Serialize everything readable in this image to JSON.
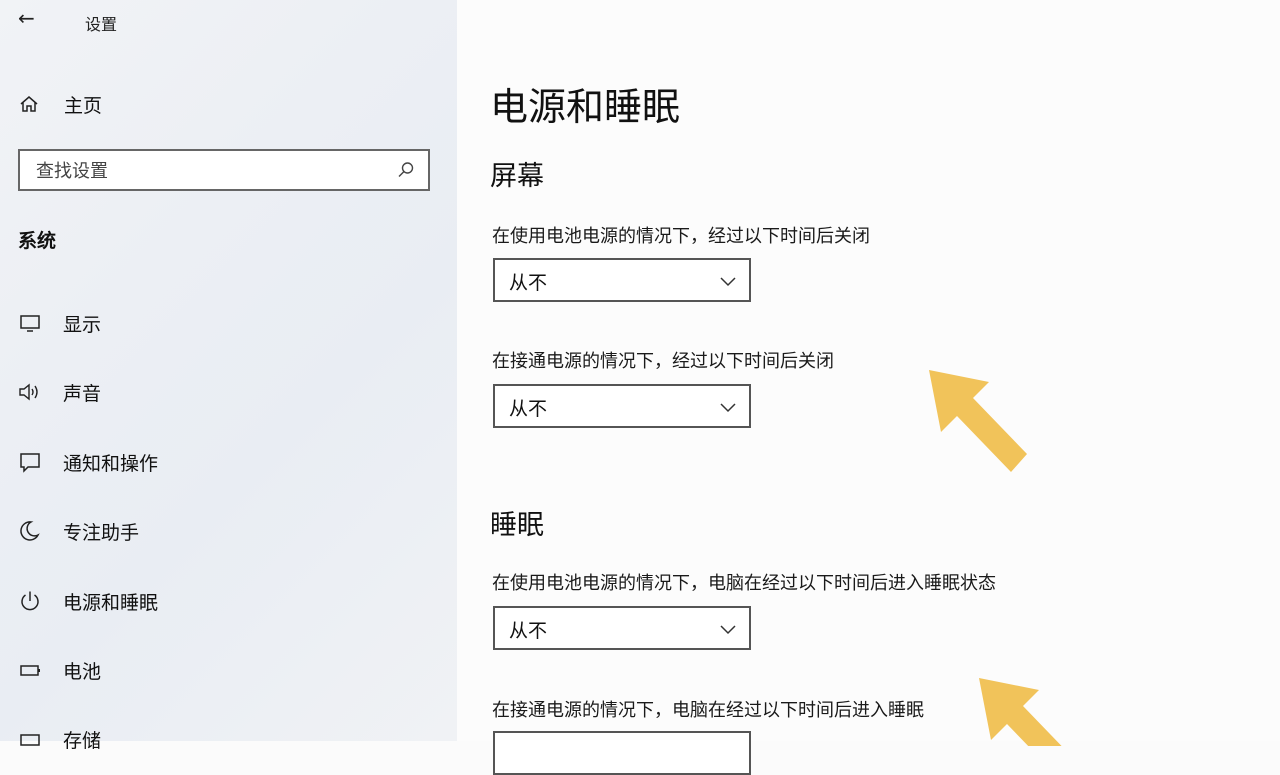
{
  "window": {
    "title": "设置"
  },
  "sidebar": {
    "home_label": "主页",
    "search_placeholder": "查找设置",
    "section_label": "系统",
    "items": [
      {
        "label": "显示",
        "icon": "monitor-icon"
      },
      {
        "label": "声音",
        "icon": "speaker-icon"
      },
      {
        "label": "通知和操作",
        "icon": "notification-icon"
      },
      {
        "label": "专注助手",
        "icon": "moon-icon"
      },
      {
        "label": "电源和睡眠",
        "icon": "power-icon"
      },
      {
        "label": "电池",
        "icon": "battery-icon"
      },
      {
        "label": "存储",
        "icon": "storage-icon"
      }
    ]
  },
  "main": {
    "title": "电源和睡眠",
    "screen": {
      "heading": "屏幕",
      "battery_label": "在使用电池电源的情况下，经过以下时间后关闭",
      "battery_value": "从不",
      "plugged_label": "在接通电源的情况下，经过以下时间后关闭",
      "plugged_value": "从不"
    },
    "sleep": {
      "heading": "睡眠",
      "battery_label": "在使用电池电源的情况下，电脑在经过以下时间后进入睡眠状态",
      "battery_value": "从不",
      "plugged_label": "在接通电源的情况下，电脑在经过以下时间后进入睡眠",
      "plugged_value": ""
    }
  },
  "annotation_color": "#f1c35a"
}
